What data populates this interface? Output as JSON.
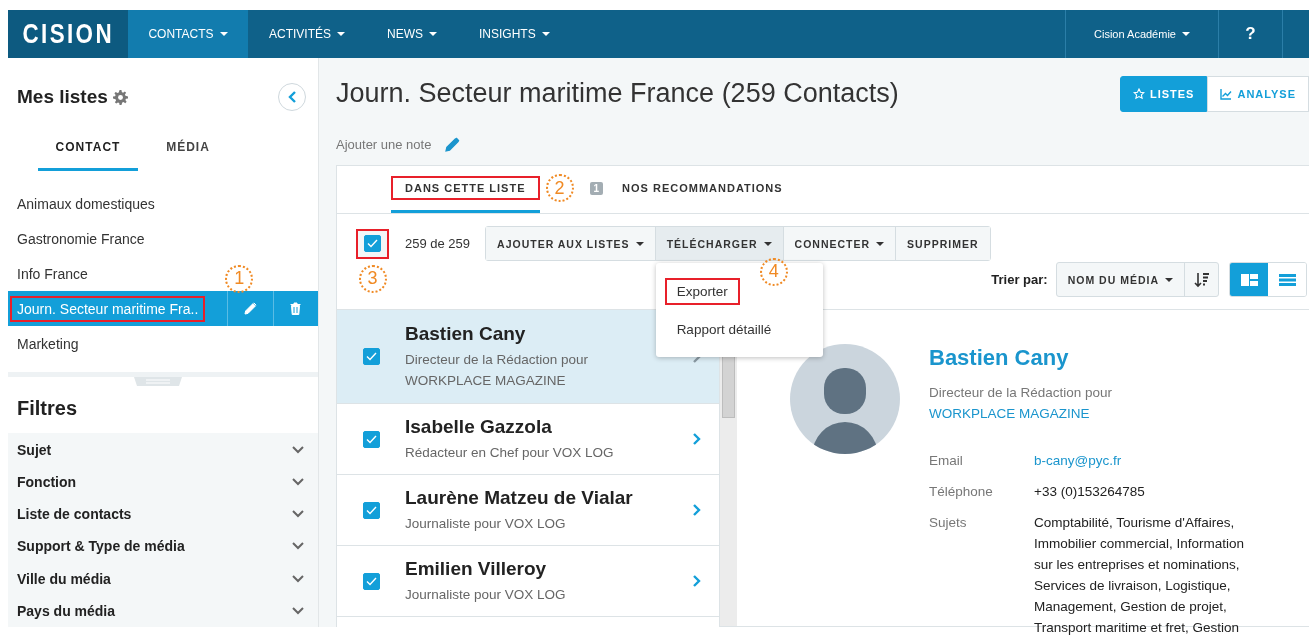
{
  "nav": {
    "logo": "CISION",
    "items": [
      {
        "label": "CONTACTS",
        "selected": true
      },
      {
        "label": "ACTIVITÉS",
        "selected": false
      },
      {
        "label": "NEWS",
        "selected": false
      },
      {
        "label": "INSIGHTS",
        "selected": false
      }
    ],
    "account": "Cision Académie",
    "help": "?"
  },
  "sidebar": {
    "title": "Mes listes",
    "tabs": [
      {
        "label": "CONTACT",
        "selected": true
      },
      {
        "label": "MÉDIA",
        "selected": false
      }
    ],
    "lists": [
      {
        "label": "Animaux domestiques",
        "selected": false,
        "highlighted": false
      },
      {
        "label": "Gastronomie France",
        "selected": false,
        "highlighted": false
      },
      {
        "label": "Info France",
        "selected": false,
        "highlighted": false
      },
      {
        "label": "Journ. Secteur maritime Fra..",
        "selected": true,
        "highlighted": true,
        "callout": {
          "number": "1"
        }
      },
      {
        "label": "Marketing",
        "selected": false,
        "highlighted": false
      }
    ],
    "filters_title": "Filtres",
    "filters": [
      {
        "label": "Sujet",
        "expanded": false
      },
      {
        "label": "Fonction",
        "expanded": false
      },
      {
        "label": "Liste de contacts",
        "expanded": false
      },
      {
        "label": "Support & Type de média",
        "expanded": false
      },
      {
        "label": "Ville du média",
        "expanded": false
      },
      {
        "label": "Pays du média",
        "expanded": false
      }
    ]
  },
  "main": {
    "title": "Journ. Secteur maritime France (259 Contacts)",
    "view_buttons": [
      {
        "label": "LISTES",
        "selected": true,
        "kind": "star"
      },
      {
        "label": "ANALYSE",
        "selected": false,
        "kind": "chart"
      }
    ],
    "note_link": "Ajouter une note",
    "tabs": [
      {
        "label": "DANS CETTE LISTE",
        "selected": true,
        "highlighted": true,
        "callout": {
          "number": "2"
        }
      },
      {
        "label": "NOS RECOMMANDATIONS",
        "selected": false,
        "highlighted": false,
        "badge": "1"
      }
    ],
    "select_all": {
      "checked": true,
      "highlighted": true,
      "callout": {
        "number": "3"
      }
    },
    "count": "259 de 259",
    "actions": [
      {
        "label": "AJOUTER AUX LISTES",
        "dropdown": true,
        "open": false
      },
      {
        "label": "TÉLÉCHARGER",
        "dropdown": true,
        "open": true
      },
      {
        "label": "CONNECTER",
        "dropdown": true,
        "open": false
      },
      {
        "label": "SUPPRIMER",
        "dropdown": false,
        "open": false
      }
    ],
    "menu": [
      {
        "label": "Exporter",
        "highlighted": true,
        "callout": {
          "number": "4"
        }
      },
      {
        "label": "Rapport détaillé",
        "highlighted": false
      }
    ],
    "sort": {
      "label": "Trier par:",
      "value": "NOM DU MÉDIA"
    },
    "layouts": [
      {
        "kind": "split",
        "selected": true
      },
      {
        "kind": "list",
        "selected": false
      }
    ],
    "contacts": [
      {
        "name": "Bastien Cany",
        "subtitle": "Directeur de la Rédaction pour WORKPLACE MAGAZINE",
        "checked": true,
        "selected": true
      },
      {
        "name": "Isabelle Gazzola",
        "subtitle": "Rédacteur en Chef pour VOX LOG",
        "checked": true,
        "selected": false
      },
      {
        "name": "Laurène Matzeu de Vialar",
        "subtitle": "Journaliste pour VOX LOG",
        "checked": true,
        "selected": false
      },
      {
        "name": "Emilien Villeroy",
        "subtitle": "Journaliste pour VOX LOG",
        "checked": true,
        "selected": false
      }
    ],
    "detail": {
      "name": "Bastien Cany",
      "role": "Directeur de la Rédaction pour",
      "outlet": "WORKPLACE MAGAZINE",
      "fields": [
        {
          "label": "Email",
          "value": "b-cany@pyc.fr",
          "kind": "link"
        },
        {
          "label": "Téléphone",
          "value": "+33 (0)153264785",
          "kind": "text"
        },
        {
          "label": "Sujets",
          "value": "Comptabilité, Tourisme d'Affaires, Immobilier commercial, Information sur les entreprises et nominations, Services de livraison, Logistique, Management, Gestion de projet, Transport maritime et fret, Gestion",
          "kind": "text"
        }
      ]
    }
  }
}
